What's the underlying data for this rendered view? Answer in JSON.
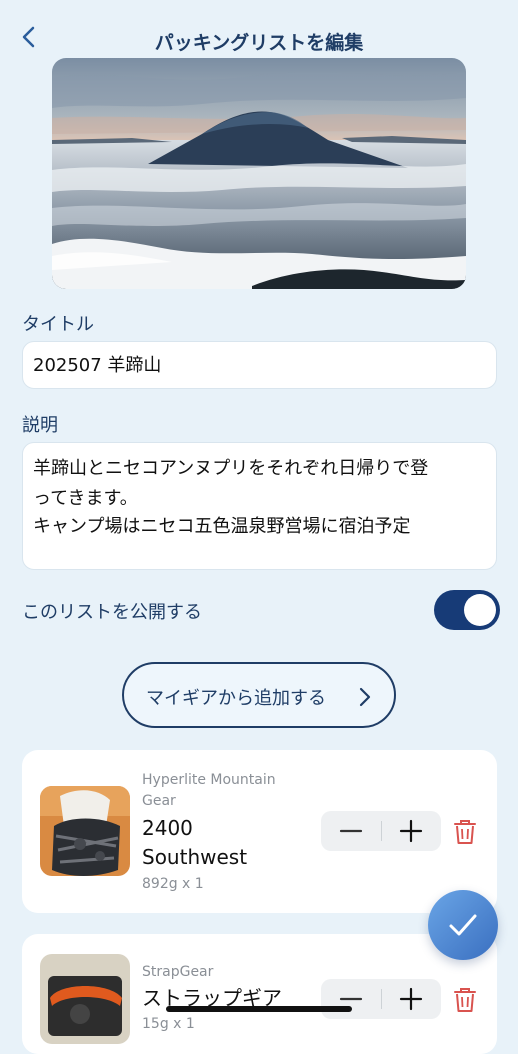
{
  "header": {
    "title": "パッキングリストを編集"
  },
  "form": {
    "title_label": "タイトル",
    "title_value": "202507 羊蹄山",
    "desc_label": "説明",
    "desc_lines": [
      "羊蹄山とニセコアンヌプリをそれぞれ日帰りで登",
      "ってきます。",
      "キャンプ場はニセコ五色温泉野営場に宿泊予定"
    ],
    "public_label": "このリストを公開する",
    "public_on": true
  },
  "add_gear_button": "マイギアから追加する",
  "items": [
    {
      "brand_line1": "Hyperlite Mountain",
      "brand_line2": "Gear",
      "name_line1": "2400",
      "name_line2": "Southwest",
      "meta": "892g x 1"
    },
    {
      "brand_line1": "StrapGear",
      "name_line1": "ストラップギア",
      "meta": "15g x 1"
    }
  ],
  "colors": {
    "accent": "#173b77",
    "text": "#1f3d66",
    "delete": "#d9534f",
    "background": "#e8f2f9"
  },
  "icons": [
    "back-chevron-icon",
    "chevron-right-icon",
    "minus-icon",
    "plus-icon",
    "trash-icon",
    "checkmark-icon"
  ]
}
